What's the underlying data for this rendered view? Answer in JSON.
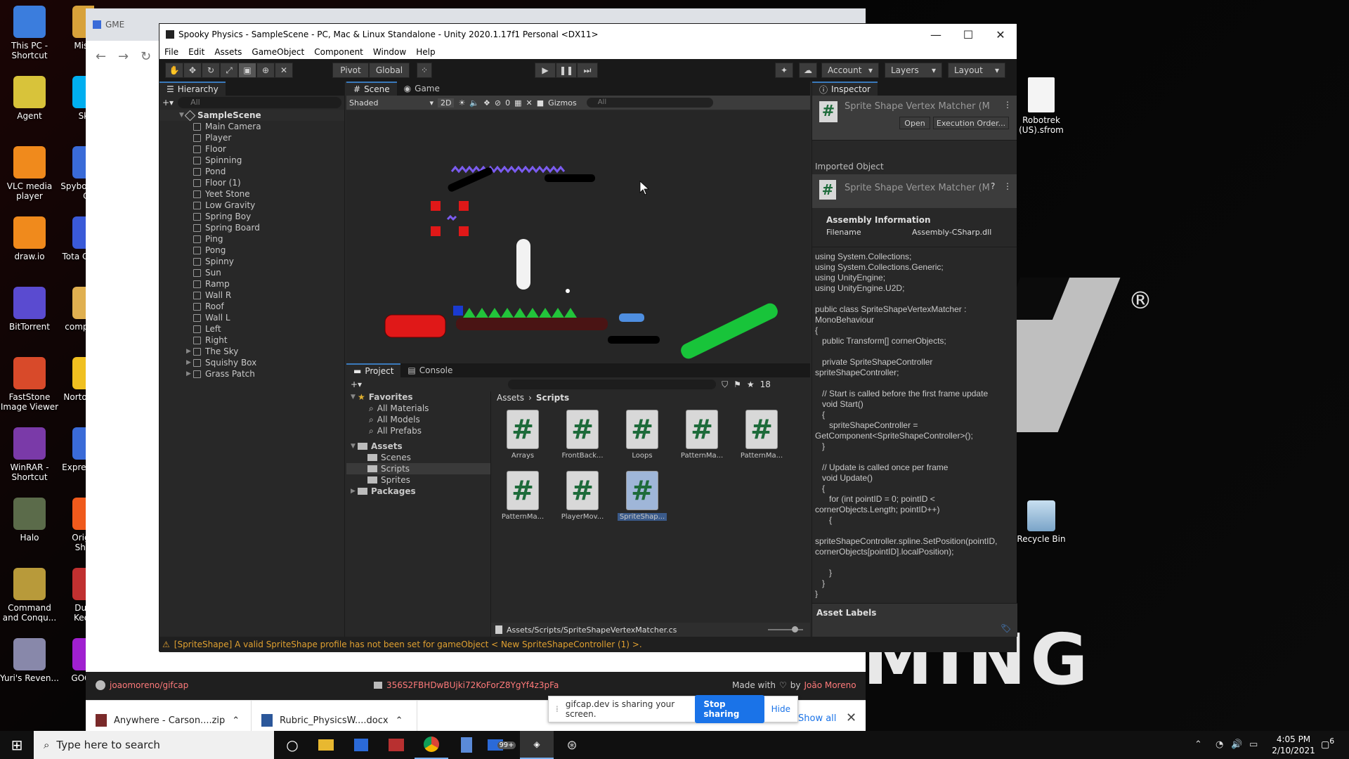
{
  "desktop": {
    "icons_left": [
      {
        "label": "This PC - Shortcut",
        "color": "#3b7ddd"
      },
      {
        "label": "Agent",
        "color": "#d8c33a"
      },
      {
        "label": "VLC media player",
        "color": "#f08a1c"
      },
      {
        "label": "draw.io",
        "color": "#f08a1c"
      },
      {
        "label": "BitTorrent",
        "color": "#5a4bd0"
      },
      {
        "label": "FastStone Image Viewer",
        "color": "#d84a2a"
      },
      {
        "label": "WinRAR - Shortcut",
        "color": "#7a3aa8"
      },
      {
        "label": "Halo",
        "color": "#5b6b4a"
      },
      {
        "label": "Command and Conqu...",
        "color": "#b89a3a"
      },
      {
        "label": "Yuri's Reven...",
        "color": "#8888aa"
      }
    ],
    "icons_second": [
      {
        "label": "Misc ju",
        "color": "#d8a23a"
      },
      {
        "label": "Skyp",
        "color": "#00aff0"
      },
      {
        "label": "Spybot- Start Ce",
        "color": "#3a6bd8"
      },
      {
        "label": "Tota Comma",
        "color": "#3a5ad8"
      },
      {
        "label": "compu tool",
        "color": "#e0b050"
      },
      {
        "label": "Norto Secur",
        "color": "#f0c020"
      },
      {
        "label": "Expre Scribe T",
        "color": "#3a6bd8"
      },
      {
        "label": "Origin.e Shortc",
        "color": "#f05a1c"
      },
      {
        "label": "Dunge Keeper",
        "color": "#c03030"
      },
      {
        "label": "GOG GA",
        "color": "#a020d0"
      }
    ],
    "icons_right": [
      {
        "label": "Robotrek (US).sfrom",
        "color": "#f2f2f2"
      },
      {
        "label": "Recycle Bin",
        "color": "#9ac0e0"
      }
    ],
    "brand_letters": "MING",
    "reg_symbol": "®"
  },
  "browser": {
    "tab_label": "GME",
    "nav": {
      "back": "←",
      "forward": "→",
      "reload": "↻"
    },
    "footer": {
      "repo": "joaomoreno/gifcap",
      "hash": "356S2FBHDwBUjki72KoForZ8YgYf4z3pFa",
      "made_with": "Made with",
      "by": "by",
      "author": "João Moreno"
    },
    "downloads": [
      {
        "name": "Anywhere - Carson....zip"
      },
      {
        "name": "Rubric_PhysicsW....docx"
      }
    ],
    "show_all": "Show all",
    "share": {
      "message": "gifcap.dev is sharing your screen.",
      "stop": "Stop sharing",
      "hide": "Hide"
    }
  },
  "unity": {
    "title": "Spooky Physics - SampleScene - PC, Mac & Linux Standalone - Unity 2020.1.17f1 Personal <DX11>",
    "menu": [
      "File",
      "Edit",
      "Assets",
      "GameObject",
      "Component",
      "Window",
      "Help"
    ],
    "toolbar": {
      "pivot": "Pivot",
      "global": "Global",
      "account": "Account",
      "layers": "Layers",
      "layout": "Layout"
    },
    "hierarchy": {
      "tab": "Hierarchy",
      "search_placeholder": "All",
      "scene": "SampleScene",
      "items": [
        "Main Camera",
        "Player",
        "Floor",
        "Spinning",
        "Pond",
        "Floor (1)",
        "Yeet Stone",
        "Low Gravity",
        "Spring Boy",
        "Spring Board",
        "Ping",
        "Pong",
        "Spinny",
        "Sun",
        "Ramp",
        "Wall R",
        "Roof",
        "Wall L",
        "Left",
        "Right",
        "The Sky",
        "Squishy Box",
        "Grass Patch"
      ]
    },
    "scene_view": {
      "tabs": [
        "Scene",
        "Game"
      ],
      "shading": "Shaded",
      "mode_2d": "2D",
      "hidden_count": "0",
      "gizmos": "Gizmos",
      "search_placeholder": "All"
    },
    "project": {
      "tabs": [
        "Project",
        "Console"
      ],
      "hidden_count": "18",
      "favorites_label": "Favorites",
      "favorites": [
        "All Materials",
        "All Models",
        "All Prefabs"
      ],
      "assets_label": "Assets",
      "asset_folders": [
        "Scenes",
        "Scripts",
        "Sprites"
      ],
      "packages_label": "Packages",
      "breadcrumb": [
        "Assets",
        "Scripts"
      ],
      "files": [
        "Arrays",
        "FrontBack...",
        "Loops",
        "PatternMa...",
        "PatternMa...",
        "PatternMa...",
        "PlayerMov...",
        "SpriteShap..."
      ],
      "status_path": "Assets/Scripts/SpriteShapeVertexMatcher.cs"
    },
    "inspector": {
      "tab": "Inspector",
      "header_title": "Sprite Shape Vertex Matcher (M",
      "open": "Open",
      "execution_order": "Execution Order...",
      "imported_object": "Imported Object",
      "imported_title": "Sprite Shape Vertex Matcher (M",
      "assembly_info": "Assembly Information",
      "filename_label": "Filename",
      "filename_value": "Assembly-CSharp.dll",
      "code": "using System.Collections;\nusing System.Collections.Generic;\nusing UnityEngine;\nusing UnityEngine.U2D;\n\npublic class SpriteShapeVertexMatcher :\nMonoBehaviour\n{\n   public Transform[] cornerObjects;\n\n   private SpriteShapeController\nspriteShapeController;\n\n   // Start is called before the first frame update\n   void Start()\n   {\n      spriteShapeController =\nGetComponent<SpriteShapeController>();\n   }\n\n   // Update is called once per frame\n   void Update()\n   {\n      for (int pointID = 0; pointID <\ncornerObjects.Length; pointID++)\n      {\n\nspriteShapeController.spline.SetPosition(pointID,\ncornerObjects[pointID].localPosition);\n\n      }\n   }\n}",
      "asset_labels": "Asset Labels"
    },
    "status_warning": "[SpriteShape] A valid SpriteShape profile has not been set for gameObject < New SpriteShapeController (1) >."
  },
  "taskbar": {
    "search_placeholder": "Type here to search",
    "time": "4:05 PM",
    "date": "2/10/2021",
    "notification_count": "6",
    "mail_badge": "99+"
  },
  "colors": {
    "unity_bg": "#282828",
    "unity_panel": "#191919",
    "accent_blue": "#1a73e8",
    "hash_green": "#1d6b3a",
    "warning": "#e0a030"
  }
}
